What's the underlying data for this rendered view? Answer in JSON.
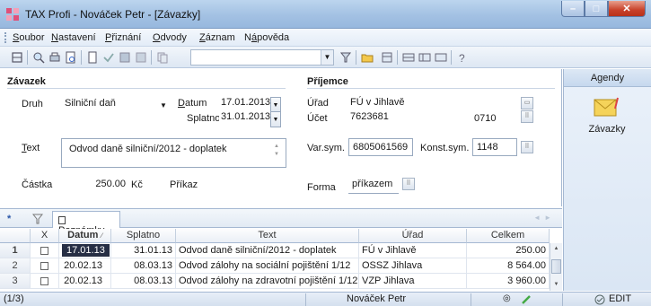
{
  "window": {
    "title": "TAX Profi - Nováček Petr - [Závazky]",
    "controls": {
      "minimize": "–",
      "maximize": "□",
      "close": "✕"
    }
  },
  "menu": [
    {
      "label": "Soubor",
      "accel": "S"
    },
    {
      "label": "Nastavení",
      "accel": "N"
    },
    {
      "label": "Přiznání",
      "accel": "P"
    },
    {
      "label": "Odvody",
      "accel": "O"
    },
    {
      "label": "Záznam",
      "accel": "Z"
    },
    {
      "label": "Nápověda",
      "accel": "á"
    }
  ],
  "form": {
    "section_left": "Závazek",
    "section_right": "Příjemce",
    "druh_label": "Druh",
    "druh_value": "Silniční daň",
    "datum_label": "Datum",
    "datum_value": "17.01.2013",
    "splatno_label": "Splatno",
    "splatno_value": "31.01.2013",
    "text_label": "Text",
    "text_value": "Odvod daně silniční/2012 - doplatek",
    "castka_label": "Částka",
    "castka_value": "250.00",
    "castka_currency": "Kč",
    "prikaz_label": "Příkaz",
    "urad_label": "Úřad",
    "urad_value": "FÚ v Jihlavě",
    "ucet_label": "Účet",
    "ucet_value": "7623681",
    "ucet_bank": "0710",
    "varsym_label": "Var.sym.",
    "varsym_value": "6805061569",
    "konstsym_label": "Konst.sym.",
    "konstsym_value": "1148",
    "forma_label": "Forma",
    "forma_value": "příkazem"
  },
  "agendy": {
    "header": "Agendy",
    "item_label": "Závazky"
  },
  "tabs": {
    "star": "*",
    "notes": "Poznámky"
  },
  "table": {
    "headers": [
      "X",
      "Datum",
      "Splatno",
      "Text",
      "Úřad",
      "Celkem"
    ],
    "rows": [
      {
        "n": "1",
        "datum": "17.01.13",
        "splatno": "31.01.13",
        "text": "Odvod daně silniční/2012 - doplatek",
        "urad": "FÚ v Jihlavě",
        "celkem": "250.00"
      },
      {
        "n": "2",
        "datum": "20.02.13",
        "splatno": "08.03.13",
        "text": "Odvod zálohy na sociální pojištění 1/12",
        "urad": "OSSZ Jihlava",
        "celkem": "8 564.00"
      },
      {
        "n": "3",
        "datum": "20.02.13",
        "splatno": "08.03.13",
        "text": "Odvod zálohy na zdravotní pojištění 1/12",
        "urad": "VZP Jihlava",
        "celkem": "3 960.00"
      }
    ]
  },
  "status": {
    "count": "(1/3)",
    "user": "Nováček Petr",
    "mode": "EDIT"
  },
  "colors": {
    "titlebar": "#a3c1e3",
    "selection": "#262e44",
    "close": "#c8412a"
  }
}
